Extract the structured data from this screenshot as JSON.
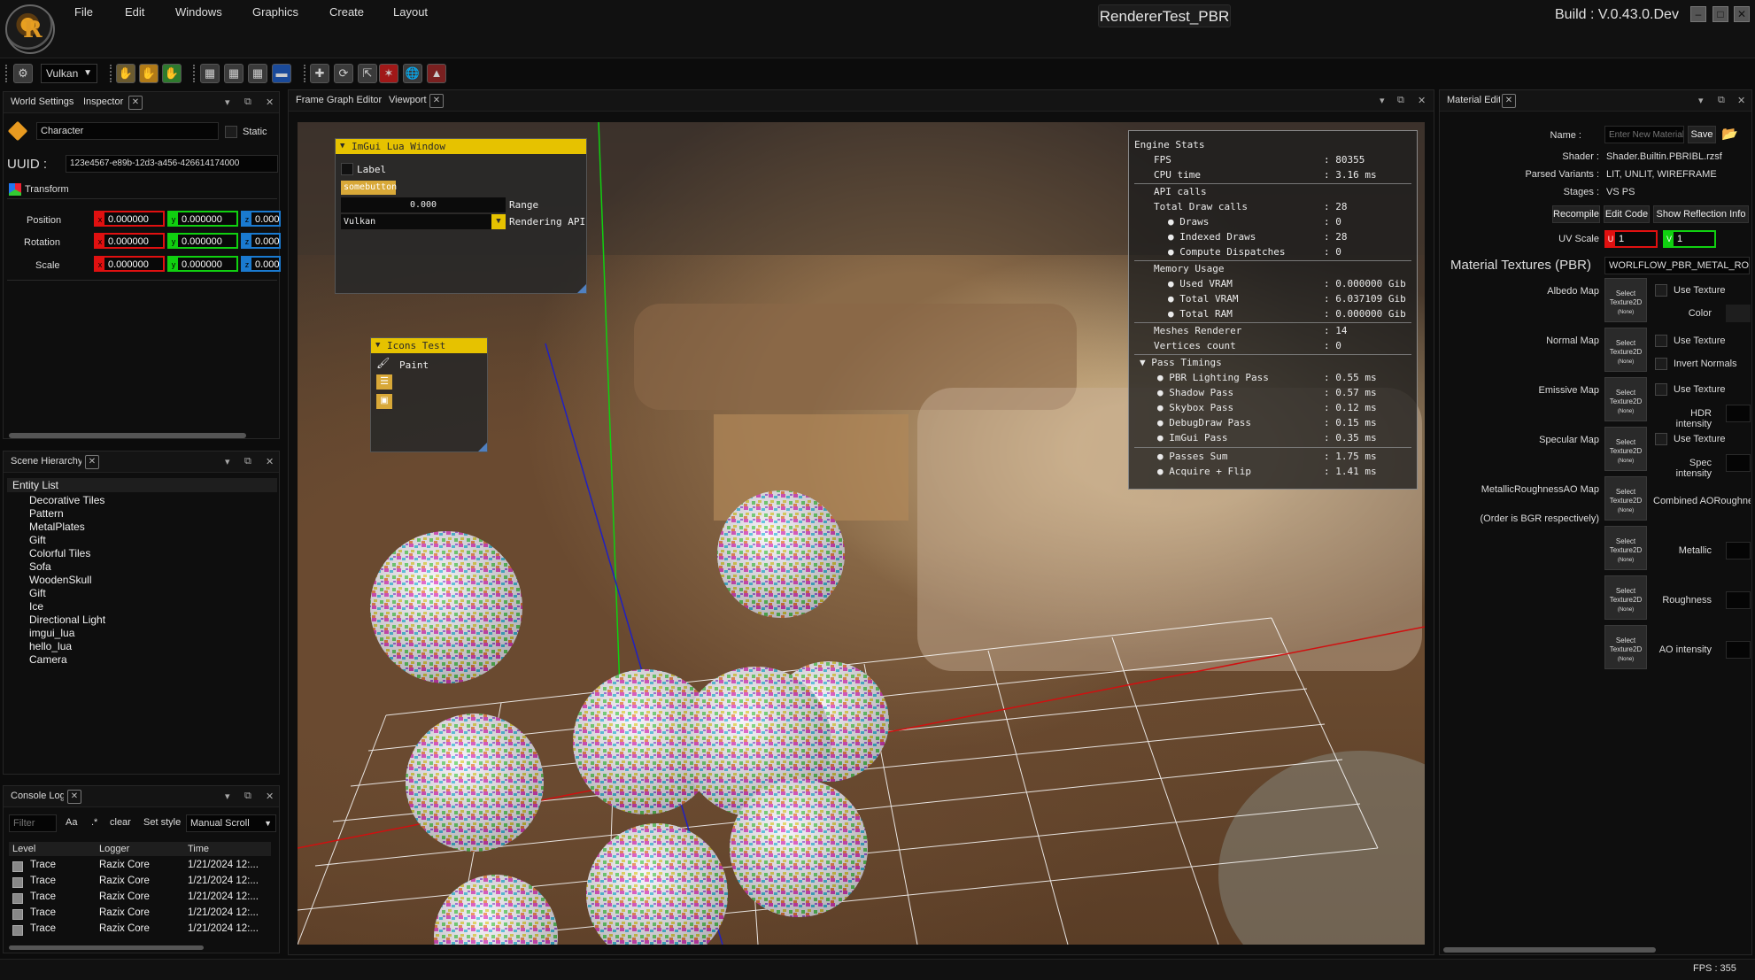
{
  "app": {
    "title": "RendererTest_PBR",
    "build": "Build : V.0.43.0.Dev",
    "menu": [
      "File",
      "Edit",
      "Windows",
      "Graphics",
      "Create",
      "Layout"
    ],
    "window_buttons": [
      "–",
      "□",
      "✕"
    ]
  },
  "toolbar": {
    "api": "Vulkan"
  },
  "left_top": {
    "tabs": [
      "World Settings",
      "Inspector"
    ],
    "entity_name": "Character",
    "static_label": "Static",
    "uuid_label": "UUID :",
    "uuid": "123e4567-e89b-12d3-a456-426614174000",
    "transform_label": "Transform",
    "rows": [
      {
        "label": "Position",
        "x": "0.000000",
        "y": "0.000000",
        "z": "0.000"
      },
      {
        "label": "Rotation",
        "x": "0.000000",
        "y": "0.000000",
        "z": "0.000"
      },
      {
        "label": "Scale",
        "x": "0.000000",
        "y": "0.000000",
        "z": "0.000"
      }
    ]
  },
  "scene": {
    "tab": "Scene Hierarchy",
    "header": "Entity List",
    "items": [
      "Decorative Tiles",
      "Pattern",
      "MetalPlates",
      "Gift",
      "Colorful Tiles",
      "Sofa",
      "WoodenSkull",
      "Gift",
      "Ice",
      "Directional Light",
      "imgui_lua",
      "hello_lua",
      "Camera"
    ]
  },
  "console": {
    "tab": "Console Log",
    "filter_placeholder": "Filter",
    "aa": "Aa",
    "regex": ".*",
    "clear": "clear",
    "set_style": "Set style",
    "scroll_mode": "Manual Scroll",
    "columns": [
      "Level",
      "Logger",
      "Time"
    ],
    "rows": [
      {
        "level": "Trace",
        "logger": "Razix Core",
        "time": "1/21/2024 12:..."
      },
      {
        "level": "Trace",
        "logger": "Razix Core",
        "time": "1/21/2024 12:..."
      },
      {
        "level": "Trace",
        "logger": "Razix Core",
        "time": "1/21/2024 12:..."
      },
      {
        "level": "Trace",
        "logger": "Razix Core",
        "time": "1/21/2024 12:..."
      },
      {
        "level": "Trace",
        "logger": "Razix Core",
        "time": "1/21/2024 12:..."
      }
    ]
  },
  "center": {
    "tabs": [
      "Frame Graph Editor",
      "Viewport"
    ]
  },
  "imgui_lua": {
    "title": "ImGui Lua Window",
    "label": "Label",
    "button": "somebutton",
    "range_value": "0.000",
    "range_label": "Range",
    "api_value": "Vulkan",
    "api_label": "Rendering API"
  },
  "icons_test": {
    "title": "Icons Test",
    "paint": "Paint"
  },
  "engine_stats": {
    "title": "Engine Stats",
    "rows": [
      {
        "name": "FPS",
        "value": "80355"
      },
      {
        "name": "CPU time",
        "value": "3.16 ms"
      },
      {
        "name": "API calls",
        "value": ""
      },
      {
        "name": "Total Draw calls",
        "value": "28"
      },
      {
        "name": "Draws",
        "value": "0"
      },
      {
        "name": "Indexed Draws",
        "value": "28"
      },
      {
        "name": "Compute Dispatches",
        "value": "0"
      },
      {
        "name": "Memory Usage",
        "value": ""
      },
      {
        "name": "Used VRAM",
        "value": "0.000000 Gib"
      },
      {
        "name": "Total VRAM",
        "value": "6.037109 Gib"
      },
      {
        "name": "Total RAM",
        "value": "0.000000 Gib"
      },
      {
        "name": "Meshes Renderer",
        "value": "14"
      },
      {
        "name": "Vertices count",
        "value": "0"
      },
      {
        "name": "Pass Timings",
        "value": ""
      },
      {
        "name": "PBR Lighting Pass",
        "value": "0.55 ms"
      },
      {
        "name": "Shadow Pass",
        "value": "0.57 ms"
      },
      {
        "name": "Skybox Pass",
        "value": "0.12 ms"
      },
      {
        "name": "DebugDraw Pass",
        "value": "0.15 ms"
      },
      {
        "name": "ImGui Pass",
        "value": "0.35 ms"
      },
      {
        "name": "Passes Sum",
        "value": "1.75 ms"
      },
      {
        "name": "Acquire + Flip",
        "value": "1.41 ms"
      }
    ]
  },
  "material": {
    "tab": "Material Editor",
    "name_label": "Name :",
    "name_placeholder": "Enter New Material",
    "save": "Save",
    "shader_label": "Shader :",
    "shader": "Shader.Builtin.PBRIBL.rzsf",
    "variants_label": "Parsed Variants :",
    "variants": "LIT, UNLIT, WIREFRAME",
    "stages_label": "Stages :",
    "stages": "VS PS",
    "recompile": "Recompile",
    "edit_code": "Edit Code",
    "show_reflection": "Show Reflection Info",
    "uv_label": "UV Scale",
    "uv_u": "1",
    "uv_v": "1",
    "textures_label": "Material Textures (PBR)",
    "workflow": "WORLFLOW_PBR_METAL_ROU",
    "select_texture": "Select Texture2D",
    "none": "(None)",
    "maps": [
      {
        "label": "Albedo Map",
        "opt1": "Use Texture",
        "opt2": "Color"
      },
      {
        "label": "Normal Map",
        "opt1": "Use Texture",
        "opt2": "Invert Normals"
      },
      {
        "label": "Emissive Map",
        "opt1": "Use Texture",
        "opt2": "HDR intensity"
      },
      {
        "label": "Specular Map",
        "opt1": "Use Texture",
        "opt2": "Spec intensity"
      },
      {
        "label": "MetallicRoughnessAO Map",
        "opt1": "Combined AORoughness",
        "opt2": ""
      }
    ],
    "order_note": "(Order is BGR respectively)",
    "extra": [
      "Metallic",
      "Roughness",
      "AO intensity"
    ]
  },
  "status": {
    "fps": "FPS : 355"
  },
  "colors": {
    "accent_yellow": "#e6c200",
    "axis_red": "#e01010",
    "axis_green": "#10d010",
    "axis_blue": "#1a7ad0"
  }
}
